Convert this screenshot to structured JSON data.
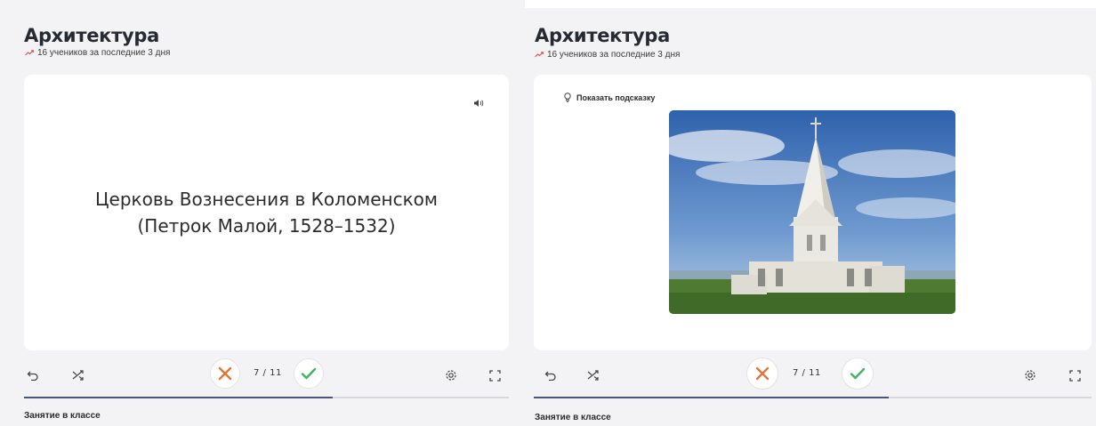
{
  "panels": [
    {
      "title": "Архитектура",
      "subtitle": "16 учеников за последние 3 дня",
      "card_line1": "Церковь Вознесения в Коломенском",
      "card_line2": "(Петрок Малой, 1528–1532)",
      "counter": "7 / 11",
      "progress": 0.636,
      "section": "Занятие в классе"
    },
    {
      "title": "Архитектура",
      "subtitle": "16 учеников за последние 3 дня",
      "hint": "Показать подсказку",
      "counter": "7 / 11",
      "progress": 0.636,
      "section": "Занятие в классе"
    }
  ],
  "colors": {
    "trend": "#e0554f",
    "wrong": "#e2753a",
    "right": "#3fb463",
    "progress": "#4a5378"
  },
  "icons": {
    "trend": "trend-up-icon",
    "speaker": "speaker-icon",
    "hint": "lightbulb-icon",
    "undo": "undo-icon",
    "shuffle": "shuffle-icon",
    "wrong": "close-icon",
    "right": "check-icon",
    "settings": "gear-icon",
    "fullscreen": "fullscreen-icon"
  }
}
